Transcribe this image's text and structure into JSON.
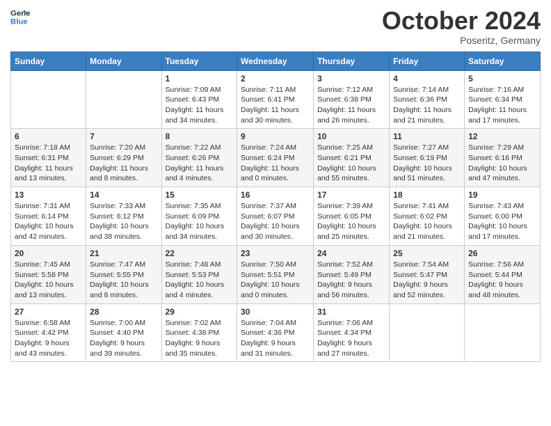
{
  "header": {
    "logo_line1": "General",
    "logo_line2": "Blue",
    "month": "October 2024",
    "location": "Poseritz, Germany"
  },
  "days_of_week": [
    "Sunday",
    "Monday",
    "Tuesday",
    "Wednesday",
    "Thursday",
    "Friday",
    "Saturday"
  ],
  "weeks": [
    [
      {
        "day": "",
        "info": ""
      },
      {
        "day": "",
        "info": ""
      },
      {
        "day": "1",
        "info": "Sunrise: 7:09 AM\nSunset: 6:43 PM\nDaylight: 11 hours\nand 34 minutes."
      },
      {
        "day": "2",
        "info": "Sunrise: 7:11 AM\nSunset: 6:41 PM\nDaylight: 11 hours\nand 30 minutes."
      },
      {
        "day": "3",
        "info": "Sunrise: 7:12 AM\nSunset: 6:38 PM\nDaylight: 11 hours\nand 26 minutes."
      },
      {
        "day": "4",
        "info": "Sunrise: 7:14 AM\nSunset: 6:36 PM\nDaylight: 11 hours\nand 21 minutes."
      },
      {
        "day": "5",
        "info": "Sunrise: 7:16 AM\nSunset: 6:34 PM\nDaylight: 11 hours\nand 17 minutes."
      }
    ],
    [
      {
        "day": "6",
        "info": "Sunrise: 7:18 AM\nSunset: 6:31 PM\nDaylight: 11 hours\nand 13 minutes."
      },
      {
        "day": "7",
        "info": "Sunrise: 7:20 AM\nSunset: 6:29 PM\nDaylight: 11 hours\nand 8 minutes."
      },
      {
        "day": "8",
        "info": "Sunrise: 7:22 AM\nSunset: 6:26 PM\nDaylight: 11 hours\nand 4 minutes."
      },
      {
        "day": "9",
        "info": "Sunrise: 7:24 AM\nSunset: 6:24 PM\nDaylight: 11 hours\nand 0 minutes."
      },
      {
        "day": "10",
        "info": "Sunrise: 7:25 AM\nSunset: 6:21 PM\nDaylight: 10 hours\nand 55 minutes."
      },
      {
        "day": "11",
        "info": "Sunrise: 7:27 AM\nSunset: 6:19 PM\nDaylight: 10 hours\nand 51 minutes."
      },
      {
        "day": "12",
        "info": "Sunrise: 7:29 AM\nSunset: 6:16 PM\nDaylight: 10 hours\nand 47 minutes."
      }
    ],
    [
      {
        "day": "13",
        "info": "Sunrise: 7:31 AM\nSunset: 6:14 PM\nDaylight: 10 hours\nand 42 minutes."
      },
      {
        "day": "14",
        "info": "Sunrise: 7:33 AM\nSunset: 6:12 PM\nDaylight: 10 hours\nand 38 minutes."
      },
      {
        "day": "15",
        "info": "Sunrise: 7:35 AM\nSunset: 6:09 PM\nDaylight: 10 hours\nand 34 minutes."
      },
      {
        "day": "16",
        "info": "Sunrise: 7:37 AM\nSunset: 6:07 PM\nDaylight: 10 hours\nand 30 minutes."
      },
      {
        "day": "17",
        "info": "Sunrise: 7:39 AM\nSunset: 6:05 PM\nDaylight: 10 hours\nand 25 minutes."
      },
      {
        "day": "18",
        "info": "Sunrise: 7:41 AM\nSunset: 6:02 PM\nDaylight: 10 hours\nand 21 minutes."
      },
      {
        "day": "19",
        "info": "Sunrise: 7:43 AM\nSunset: 6:00 PM\nDaylight: 10 hours\nand 17 minutes."
      }
    ],
    [
      {
        "day": "20",
        "info": "Sunrise: 7:45 AM\nSunset: 5:58 PM\nDaylight: 10 hours\nand 13 minutes."
      },
      {
        "day": "21",
        "info": "Sunrise: 7:47 AM\nSunset: 5:55 PM\nDaylight: 10 hours\nand 8 minutes."
      },
      {
        "day": "22",
        "info": "Sunrise: 7:48 AM\nSunset: 5:53 PM\nDaylight: 10 hours\nand 4 minutes."
      },
      {
        "day": "23",
        "info": "Sunrise: 7:50 AM\nSunset: 5:51 PM\nDaylight: 10 hours\nand 0 minutes."
      },
      {
        "day": "24",
        "info": "Sunrise: 7:52 AM\nSunset: 5:49 PM\nDaylight: 9 hours\nand 56 minutes."
      },
      {
        "day": "25",
        "info": "Sunrise: 7:54 AM\nSunset: 5:47 PM\nDaylight: 9 hours\nand 52 minutes."
      },
      {
        "day": "26",
        "info": "Sunrise: 7:56 AM\nSunset: 5:44 PM\nDaylight: 9 hours\nand 48 minutes."
      }
    ],
    [
      {
        "day": "27",
        "info": "Sunrise: 6:58 AM\nSunset: 4:42 PM\nDaylight: 9 hours\nand 43 minutes."
      },
      {
        "day": "28",
        "info": "Sunrise: 7:00 AM\nSunset: 4:40 PM\nDaylight: 9 hours\nand 39 minutes."
      },
      {
        "day": "29",
        "info": "Sunrise: 7:02 AM\nSunset: 4:38 PM\nDaylight: 9 hours\nand 35 minutes."
      },
      {
        "day": "30",
        "info": "Sunrise: 7:04 AM\nSunset: 4:36 PM\nDaylight: 9 hours\nand 31 minutes."
      },
      {
        "day": "31",
        "info": "Sunrise: 7:06 AM\nSunset: 4:34 PM\nDaylight: 9 hours\nand 27 minutes."
      },
      {
        "day": "",
        "info": ""
      },
      {
        "day": "",
        "info": ""
      }
    ]
  ]
}
